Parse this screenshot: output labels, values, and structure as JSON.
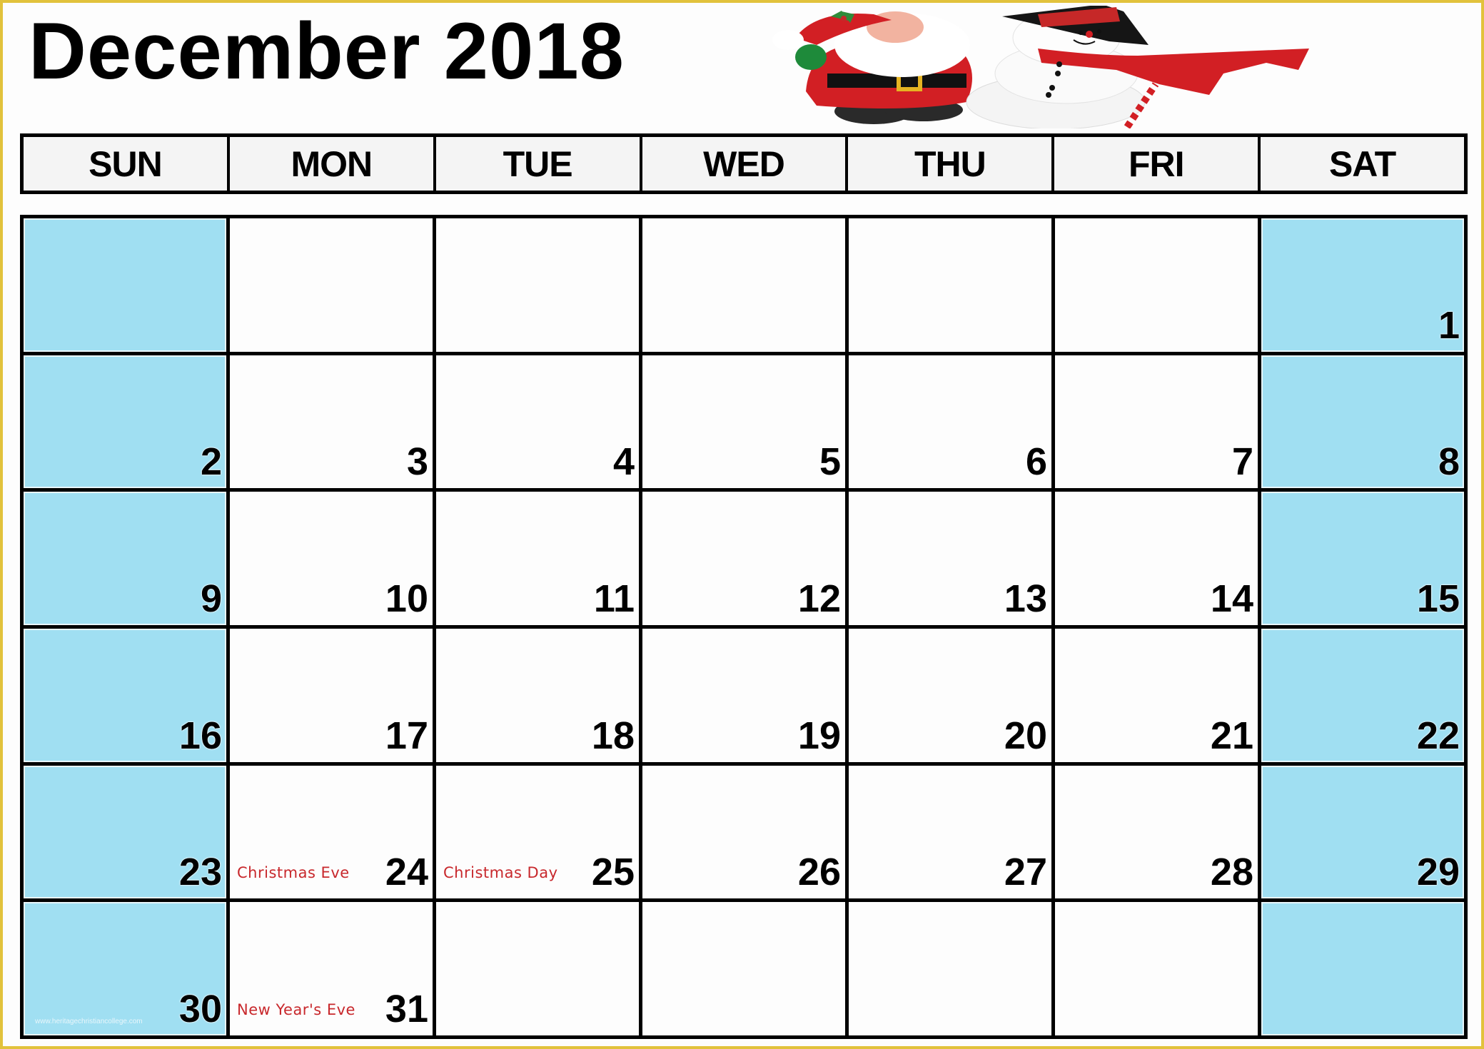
{
  "calendar": {
    "title": "December 2018",
    "month": "December",
    "year": 2018,
    "colors": {
      "border": "#e2c23c",
      "weekend_fill": "#a0dff2",
      "holiday_text": "#c8282c",
      "header_fill": "#f4f4f4"
    },
    "illustration": "santa-and-snowman",
    "weekdays": [
      "SUN",
      "MON",
      "TUE",
      "WED",
      "THU",
      "FRI",
      "SAT"
    ],
    "weeks": [
      [
        {
          "day": ""
        },
        {
          "day": ""
        },
        {
          "day": ""
        },
        {
          "day": ""
        },
        {
          "day": ""
        },
        {
          "day": ""
        },
        {
          "day": "1"
        }
      ],
      [
        {
          "day": "2"
        },
        {
          "day": "3"
        },
        {
          "day": "4"
        },
        {
          "day": "5"
        },
        {
          "day": "6"
        },
        {
          "day": "7"
        },
        {
          "day": "8"
        }
      ],
      [
        {
          "day": "9"
        },
        {
          "day": "10"
        },
        {
          "day": "11"
        },
        {
          "day": "12"
        },
        {
          "day": "13"
        },
        {
          "day": "14"
        },
        {
          "day": "15"
        }
      ],
      [
        {
          "day": "16"
        },
        {
          "day": "17"
        },
        {
          "day": "18"
        },
        {
          "day": "19"
        },
        {
          "day": "20"
        },
        {
          "day": "21"
        },
        {
          "day": "22"
        }
      ],
      [
        {
          "day": "23"
        },
        {
          "day": "24",
          "holiday": "Christmas Eve"
        },
        {
          "day": "25",
          "holiday": "Christmas Day"
        },
        {
          "day": "26"
        },
        {
          "day": "27"
        },
        {
          "day": "28"
        },
        {
          "day": "29"
        }
      ],
      [
        {
          "day": "30",
          "watermark": "www.heritagechristiancollege.com"
        },
        {
          "day": "31",
          "holiday": "New Year's Eve"
        },
        {
          "day": ""
        },
        {
          "day": ""
        },
        {
          "day": ""
        },
        {
          "day": ""
        },
        {
          "day": ""
        }
      ]
    ]
  }
}
